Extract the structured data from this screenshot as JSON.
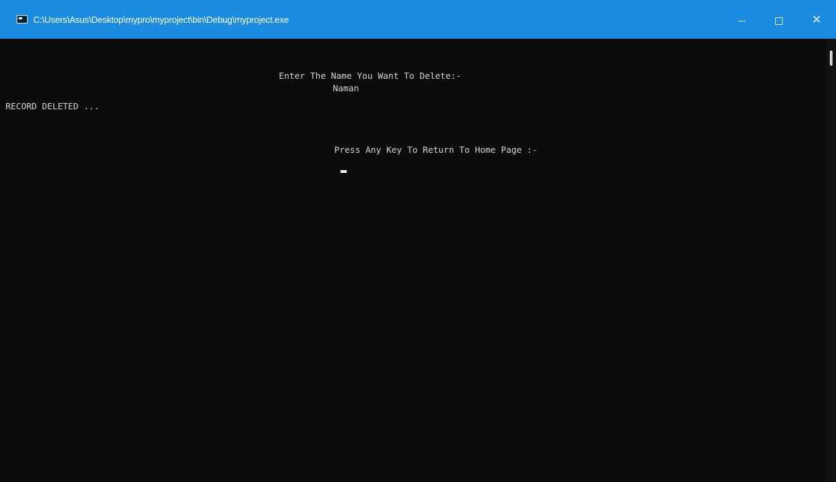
{
  "window": {
    "title": "C:\\Users\\Asus\\Desktop\\mypro\\myproject\\bin\\Debug\\myproject.exe",
    "icon": "console-window-icon",
    "controls": {
      "minimize": "minimize-icon",
      "maximize": "maximize-icon",
      "close_glyph": "✕"
    },
    "titlebar_color": "#1b8ce0",
    "console_bg": "#0c0c0c",
    "text_color": "#d4d4d4"
  },
  "console": {
    "lines": [
      "Enter The Name You Want To Delete:-",
      "Naman",
      "RECORD DELETED ...",
      "Press Any Key To Return To Home Page :-"
    ]
  }
}
